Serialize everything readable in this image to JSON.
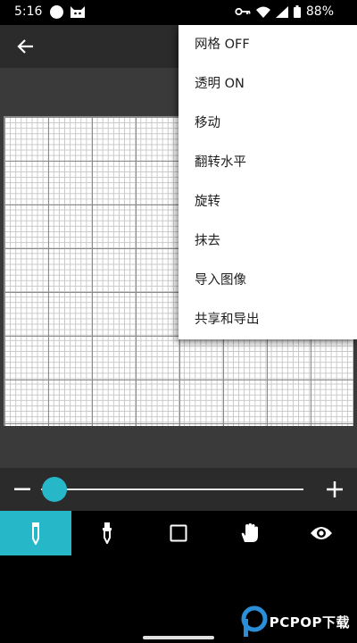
{
  "status_bar": {
    "time": "5:16",
    "battery": "88%",
    "icons": [
      "circle-notification-icon",
      "cat-notification-icon",
      "key-icon",
      "wifi-icon",
      "signal-icon",
      "battery-icon"
    ]
  },
  "app_bar": {
    "back_icon": "arrow-back-icon"
  },
  "menu": {
    "items": [
      "网格 OFF",
      "透明 ON",
      "移动",
      "翻转水平",
      "旋转",
      "抹去",
      "导入图像",
      "共享和导出"
    ]
  },
  "slider": {
    "value_fraction": 0.05,
    "accent": "#26b8c8"
  },
  "toolbar": {
    "tools": [
      "pencil-icon",
      "dropper-icon",
      "square-icon",
      "hand-icon",
      "eye-icon"
    ],
    "active_index": 0
  },
  "watermark": {
    "text": "PCPOP下载"
  },
  "colors": {
    "accent": "#26b8c8",
    "app_bar": "#2b2b2b",
    "workspace": "#3a3a3a"
  }
}
